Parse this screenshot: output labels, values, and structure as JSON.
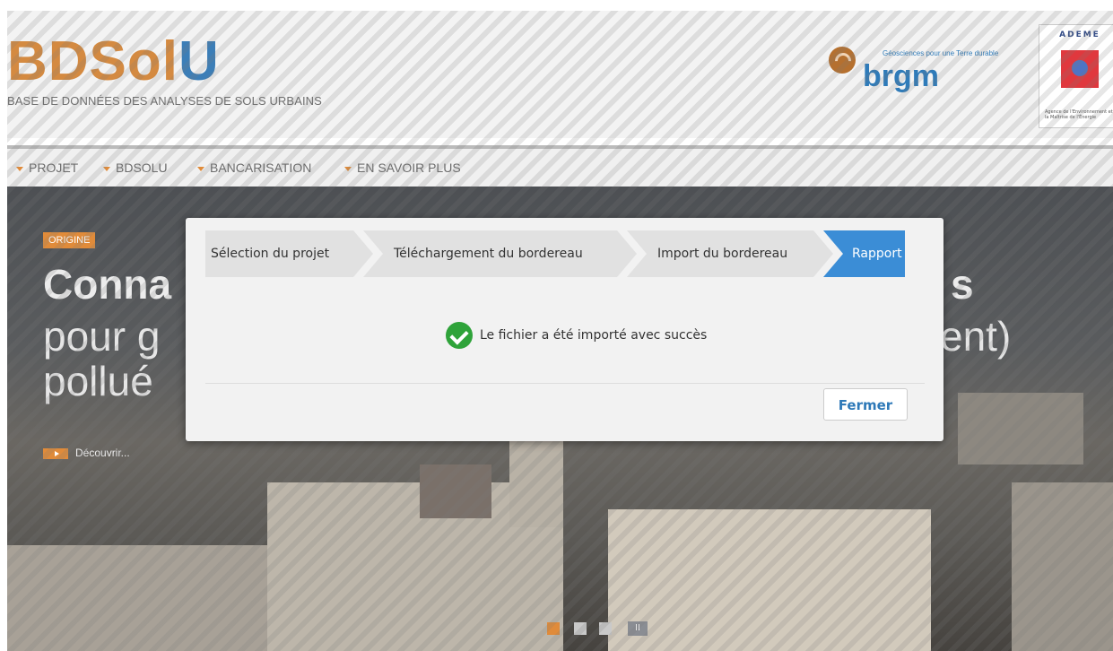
{
  "header": {
    "logo": {
      "part1": "BDSol",
      "part2": "U"
    },
    "subtitle": "BASE DE DONNÉES DES ANALYSES DE SOLS URBAINS",
    "brgm": {
      "word": "brgm",
      "tagline": "Géosciences pour une Terre durable"
    },
    "ademe": {
      "title": "ADEME",
      "text": "Agence de l'Environnement et de la Maîtrise de l'Énergie"
    }
  },
  "nav": {
    "items": [
      {
        "label": "PROJET"
      },
      {
        "label": "BDSOLU"
      },
      {
        "label": "BANCARISATION"
      },
      {
        "label": "EN SAVOIR PLUS"
      }
    ]
  },
  "hero": {
    "badge": "ORIGINE",
    "title_left": "Conna",
    "line2_left": "pour g",
    "line3_left": "pollué",
    "title_right": "s",
    "line2_right": "ent)",
    "link": "Découvrir..."
  },
  "modal": {
    "steps": [
      {
        "label": "Sélection du projet",
        "active": false
      },
      {
        "label": "Téléchargement du bordereau",
        "active": false
      },
      {
        "label": "Import du bordereau",
        "active": false
      },
      {
        "label": "Rapport",
        "active": true
      }
    ],
    "message": "Le fichier a été importé avec succès",
    "close_label": "Fermer"
  },
  "carousel": {
    "pause_label": "II"
  },
  "colors": {
    "accent_orange": "#e08b3a",
    "brand_blue": "#3c7eb7",
    "active_step": "#3b8dd6",
    "success_green": "#2fa33a"
  }
}
